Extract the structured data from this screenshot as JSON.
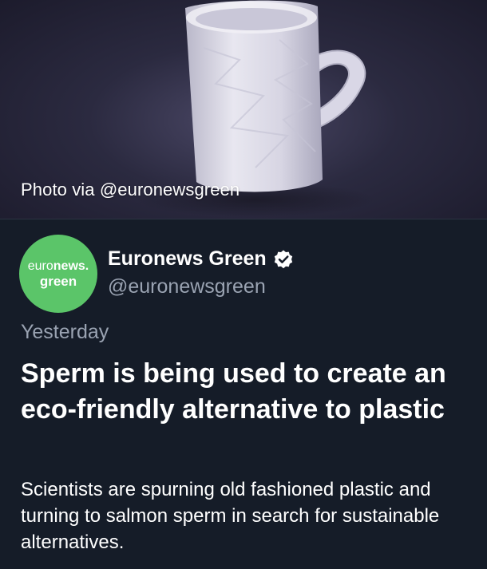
{
  "photo": {
    "caption": "Photo via @euronewsgreen"
  },
  "author": {
    "avatar_line1_light": "euro",
    "avatar_line1_bold": "news.",
    "avatar_line2": "green",
    "name": "Euronews Green",
    "handle": "@euronewsgreen",
    "verified_icon": "verified-badge-icon"
  },
  "post": {
    "timestamp": "Yesterday",
    "headline": "Sperm is being used to create an eco-friendly alternative to plastic",
    "summary": "Scientists are spurning old fashioned plastic and turning to salmon sperm in search for sustainable alternatives."
  },
  "colors": {
    "background": "#151c28",
    "avatar": "#5bc569",
    "muted_text": "#9aa3b2"
  }
}
